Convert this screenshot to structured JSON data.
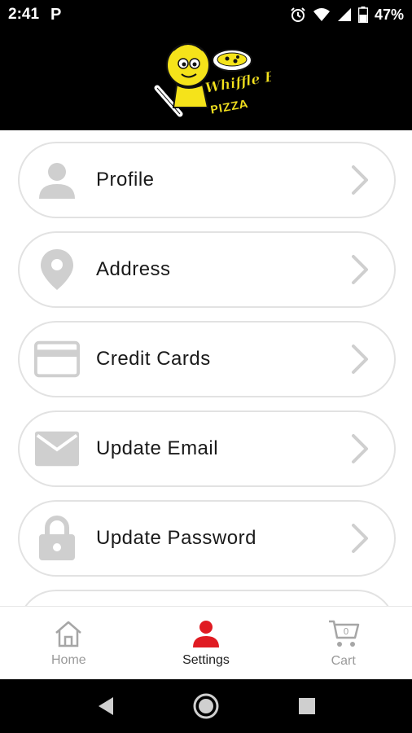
{
  "status_bar": {
    "time": "2:41",
    "notification_app": "P",
    "battery": "47%",
    "icons": [
      "alarm-icon",
      "wifi-icon",
      "signal-icon",
      "battery-icon"
    ]
  },
  "header": {
    "logo_name": "whiffle-boys-pizza-logo",
    "logo_text": "Whiffle Boy's Pizza"
  },
  "menu": {
    "items": [
      {
        "label": "Profile",
        "icon": "person-icon"
      },
      {
        "label": "Address",
        "icon": "location-pin-icon"
      },
      {
        "label": "Credit Cards",
        "icon": "credit-card-icon"
      },
      {
        "label": "Update Email",
        "icon": "envelope-icon"
      },
      {
        "label": "Update Password",
        "icon": "lock-icon"
      }
    ]
  },
  "bottom_nav": {
    "home": "Home",
    "settings": "Settings",
    "cart": "Cart",
    "cart_count": "0",
    "active": "settings"
  },
  "colors": {
    "active_accent": "#e01b22",
    "icon_gray": "#cfcfcf",
    "border_gray": "#e2e2e2",
    "logo_yellow": "#f5e31a"
  }
}
